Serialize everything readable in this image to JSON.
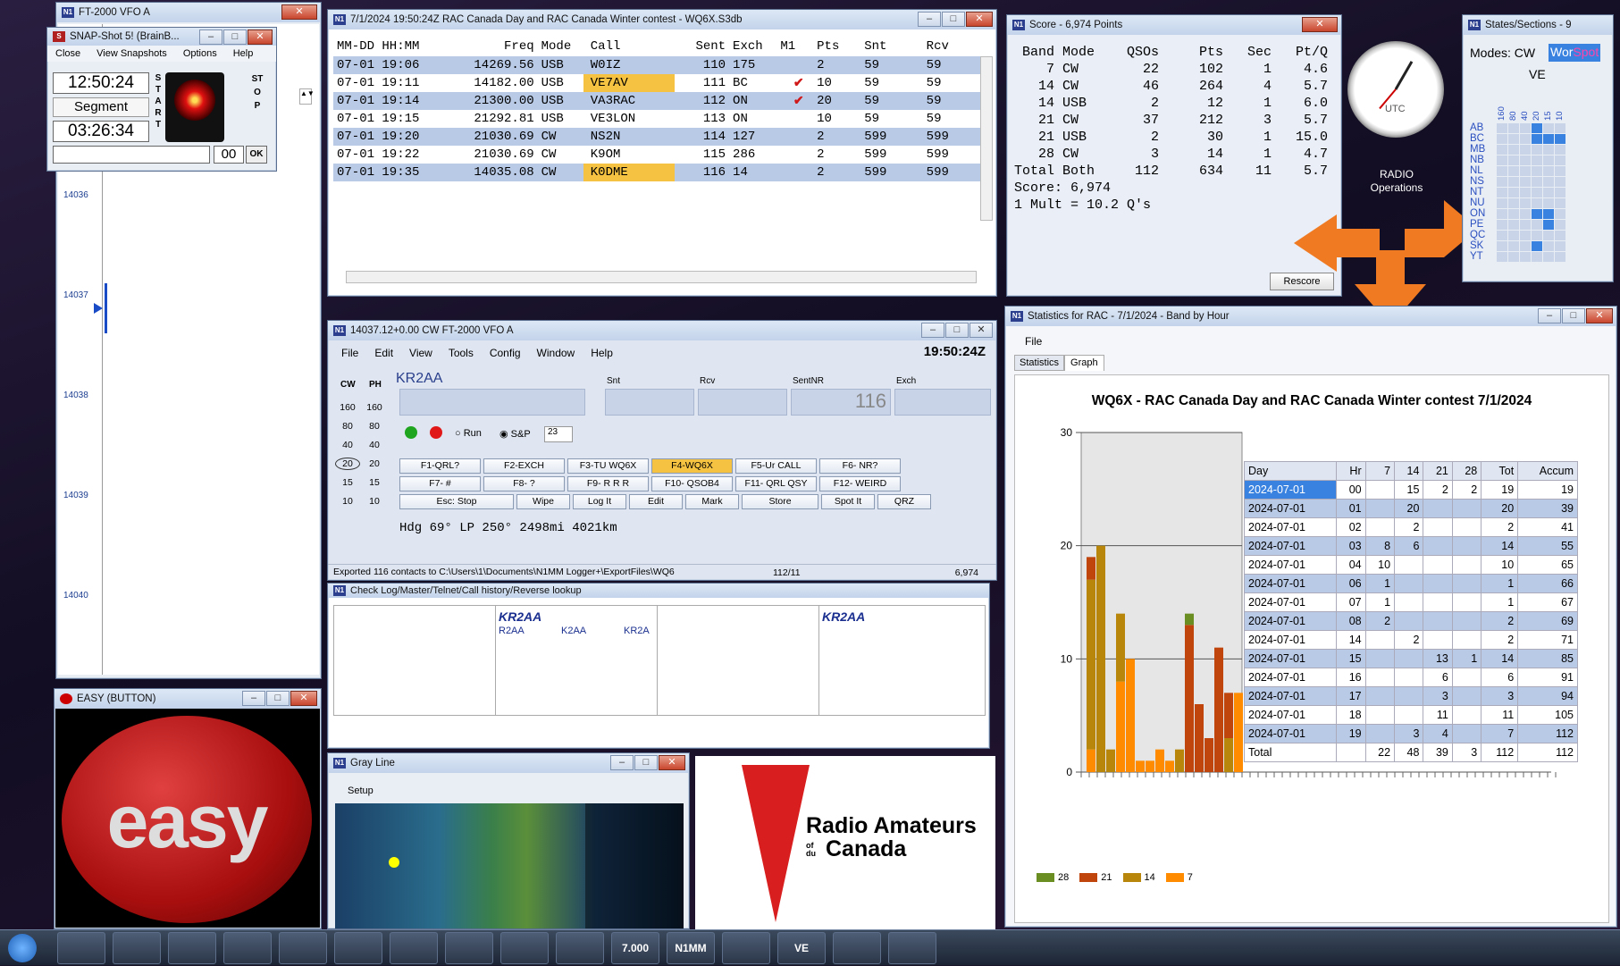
{
  "vfo_left": {
    "title": "FT-2000 VFO A",
    "freq_labels": [
      "14036",
      "14037",
      "14038",
      "14039",
      "14040"
    ]
  },
  "snap": {
    "title": "SNAP-Shot 5! (BrainB...",
    "menu": [
      "Close",
      "View Snapshots",
      "Options",
      "Help"
    ],
    "clock": "12:50:24",
    "segment": "Segment",
    "timer": "03:26:34",
    "start": "START",
    "stop": "STOP",
    "counter": "00",
    "ok": "OK"
  },
  "easy": {
    "title": "EASY (BUTTON)",
    "text": "easy"
  },
  "log": {
    "title": "7/1/2024 19:50:24Z  RAC Canada Day and RAC Canada Winter contest - WQ6X.S3db",
    "headers": [
      "MM-DD HH:MM",
      "Freq",
      "Mode",
      "Call",
      "Sent",
      "Exch",
      "M1",
      "Pts",
      "Snt",
      "Rcv"
    ],
    "rows": [
      [
        "07-01 19:06",
        "14269.56",
        "USB",
        "W0IZ",
        "110",
        "175",
        "",
        "2",
        "59",
        "59"
      ],
      [
        "07-01 19:11",
        "14182.00",
        "USB",
        "VE7AV",
        "111",
        "BC",
        "✔",
        "10",
        "59",
        "59"
      ],
      [
        "07-01 19:14",
        "21300.00",
        "USB",
        "VA3RAC",
        "112",
        "ON",
        "✔",
        "20",
        "59",
        "59"
      ],
      [
        "07-01 19:15",
        "21292.81",
        "USB",
        "VE3LON",
        "113",
        "ON",
        "",
        "10",
        "59",
        "59"
      ],
      [
        "07-01 19:20",
        "21030.69",
        "CW",
        "NS2N",
        "114",
        "127",
        "",
        "2",
        "599",
        "599"
      ],
      [
        "07-01 19:22",
        "21030.69",
        "CW",
        "K9OM",
        "115",
        "286",
        "",
        "2",
        "599",
        "599"
      ],
      [
        "07-01 19:35",
        "14035.08",
        "CW",
        "K0DME",
        "116",
        "14",
        "",
        "2",
        "599",
        "599"
      ]
    ],
    "highlight_color": "#f5c242"
  },
  "score": {
    "title": "Score - 6,974 Points",
    "headers": [
      "Band",
      "Mode",
      "QSOs",
      "Pts",
      "Sec",
      "Pt/Q"
    ],
    "rows": [
      [
        "7",
        "CW",
        "22",
        "102",
        "1",
        "4.6"
      ],
      [
        "14",
        "CW",
        "46",
        "264",
        "4",
        "5.7"
      ],
      [
        "14",
        "USB",
        "2",
        "12",
        "1",
        "6.0"
      ],
      [
        "21",
        "CW",
        "37",
        "212",
        "3",
        "5.7"
      ],
      [
        "21",
        "USB",
        "2",
        "30",
        "1",
        "15.0"
      ],
      [
        "28",
        "CW",
        "3",
        "14",
        "1",
        "4.7"
      ],
      [
        "Total",
        "Both",
        "112",
        "634",
        "11",
        "5.7"
      ]
    ],
    "score_line": "Score: 6,974",
    "mult_line": "1 Mult = 10.2 Q's",
    "rescore": "Rescore"
  },
  "clock": {
    "label1": "RADIO",
    "label2": "Operations",
    "utc": "UTC"
  },
  "states": {
    "title": "States/Sections - 9",
    "modes": "Modes: CW",
    "worked": "Wor",
    "spot": "Spot",
    "country": "VE",
    "bands": [
      "160",
      "80",
      "40",
      "20",
      "15",
      "10"
    ],
    "sections": [
      "AB",
      "BC",
      "MB",
      "NB",
      "NL",
      "NS",
      "NT",
      "NU",
      "ON",
      "PE",
      "QC",
      "SK",
      "YT"
    ]
  },
  "entry": {
    "title": "14037.12+0.00 CW FT-2000 VFO A",
    "menu": [
      "File",
      "Edit",
      "View",
      "Tools",
      "Config",
      "Window",
      "Help"
    ],
    "time": "19:50:24Z",
    "call": "KR2AA",
    "labels": {
      "snt": "Snt",
      "rcv": "Rcv",
      "sentnr": "SentNR",
      "exch": "Exch"
    },
    "sentnr": "116",
    "cw": "CW",
    "ph": "PH",
    "bands": [
      "160",
      "80",
      "40",
      "20",
      "15",
      "10"
    ],
    "run": "Run",
    "sp": "S&P",
    "spin": "23",
    "fkeys": [
      "F1-QRL?",
      "F2-EXCH",
      "F3-TU WQ6X",
      "F4-WQ6X",
      "F5-Ur CALL",
      "F6- NR?",
      "F7- #",
      "F8- ?",
      "F9- R R R",
      "F10- QSOB4",
      "F11- QRL QSY",
      "F12- WEIRD"
    ],
    "row3": [
      "Esc: Stop",
      "Wipe",
      "Log It",
      "Edit",
      "Mark",
      "Store",
      "Spot It",
      "QRZ"
    ],
    "heading": "Hdg 69°  LP 250°  2498mi  4021km",
    "status": "Exported 116 contacts to C:\\Users\\1\\Documents\\N1MM Logger+\\ExportFiles\\WQ6",
    "status_count": "112/11",
    "status_score": "6,974"
  },
  "check": {
    "title": "Check Log/Master/Telnet/Call history/Reverse lookup",
    "call": "KR2AA",
    "partials": [
      "R2AA",
      "K2AA",
      "KR2A"
    ],
    "call2": "KR2AA"
  },
  "grayline": {
    "title": "Gray Line",
    "setup": "Setup"
  },
  "rac": {
    "line1": "Radio Amateurs",
    "line2": "Canada",
    "of": "of",
    "du": "du"
  },
  "stats": {
    "title": "Statistics for RAC - 7/1/2024 - Band by Hour",
    "menu": "File",
    "tabs": [
      "Statistics",
      "Graph"
    ],
    "chart_title": "WQ6X - RAC Canada Day and RAC Canada Winter contest 7/1/2024",
    "table_headers": [
      "Day",
      "Hr",
      "7",
      "14",
      "21",
      "28",
      "Tot",
      "Accum"
    ],
    "table_rows": [
      [
        "2024-07-01",
        "00",
        "",
        "15",
        "2",
        "2",
        "19",
        "19"
      ],
      [
        "2024-07-01",
        "01",
        "",
        "20",
        "",
        "",
        "20",
        "39"
      ],
      [
        "2024-07-01",
        "02",
        "",
        "2",
        "",
        "",
        "2",
        "41"
      ],
      [
        "2024-07-01",
        "03",
        "8",
        "6",
        "",
        "",
        "14",
        "55"
      ],
      [
        "2024-07-01",
        "04",
        "10",
        "",
        "",
        "",
        "10",
        "65"
      ],
      [
        "2024-07-01",
        "06",
        "1",
        "",
        "",
        "",
        "1",
        "66"
      ],
      [
        "2024-07-01",
        "07",
        "1",
        "",
        "",
        "",
        "1",
        "67"
      ],
      [
        "2024-07-01",
        "08",
        "2",
        "",
        "",
        "",
        "2",
        "69"
      ],
      [
        "2024-07-01",
        "14",
        "",
        "2",
        "",
        "",
        "2",
        "71"
      ],
      [
        "2024-07-01",
        "15",
        "",
        "",
        "13",
        "1",
        "14",
        "85"
      ],
      [
        "2024-07-01",
        "16",
        "",
        "",
        "6",
        "",
        "6",
        "91"
      ],
      [
        "2024-07-01",
        "17",
        "",
        "",
        "3",
        "",
        "3",
        "94"
      ],
      [
        "2024-07-01",
        "18",
        "",
        "",
        "11",
        "",
        "11",
        "105"
      ],
      [
        "2024-07-01",
        "19",
        "",
        "3",
        "4",
        "",
        "7",
        "112"
      ],
      [
        "Total",
        "",
        "22",
        "48",
        "39",
        "3",
        "112",
        "112"
      ]
    ]
  },
  "chart_data": {
    "type": "bar",
    "title": "WQ6X - RAC Canada Day and RAC Canada Winter contest 7/1/2024",
    "ylim": [
      0,
      30
    ],
    "yticks": [
      "0",
      "10",
      "20",
      "30"
    ],
    "series": [
      {
        "name": "28",
        "color": "#6b8e23"
      },
      {
        "name": "21",
        "color": "#c0450c"
      },
      {
        "name": "14",
        "color": "#b8860b"
      },
      {
        "name": "7",
        "color": "#ff8c00"
      }
    ],
    "stacks": [
      [
        0,
        2,
        15,
        2
      ],
      [
        0,
        0,
        20,
        0
      ],
      [
        0,
        0,
        2,
        0
      ],
      [
        0,
        0,
        6,
        8
      ],
      [
        0,
        0,
        0,
        10
      ],
      [
        0,
        0,
        0,
        1
      ],
      [
        0,
        0,
        0,
        1
      ],
      [
        0,
        0,
        0,
        2
      ],
      [
        0,
        0,
        0,
        1
      ],
      [
        0,
        0,
        2,
        0
      ],
      [
        1,
        13,
        0,
        0
      ],
      [
        0,
        6,
        0,
        0
      ],
      [
        0,
        3,
        0,
        0
      ],
      [
        0,
        11,
        0,
        0
      ],
      [
        0,
        4,
        3,
        0
      ],
      [
        0,
        0,
        0,
        7
      ]
    ]
  },
  "taskbar": {
    "items": [
      "cmd",
      "img",
      "play",
      "folder",
      "chrome",
      "firefox",
      "shield",
      "app",
      "hal",
      "stop",
      "7.000",
      "N1MM",
      "ie",
      "VE",
      "term",
      "vlc"
    ]
  }
}
